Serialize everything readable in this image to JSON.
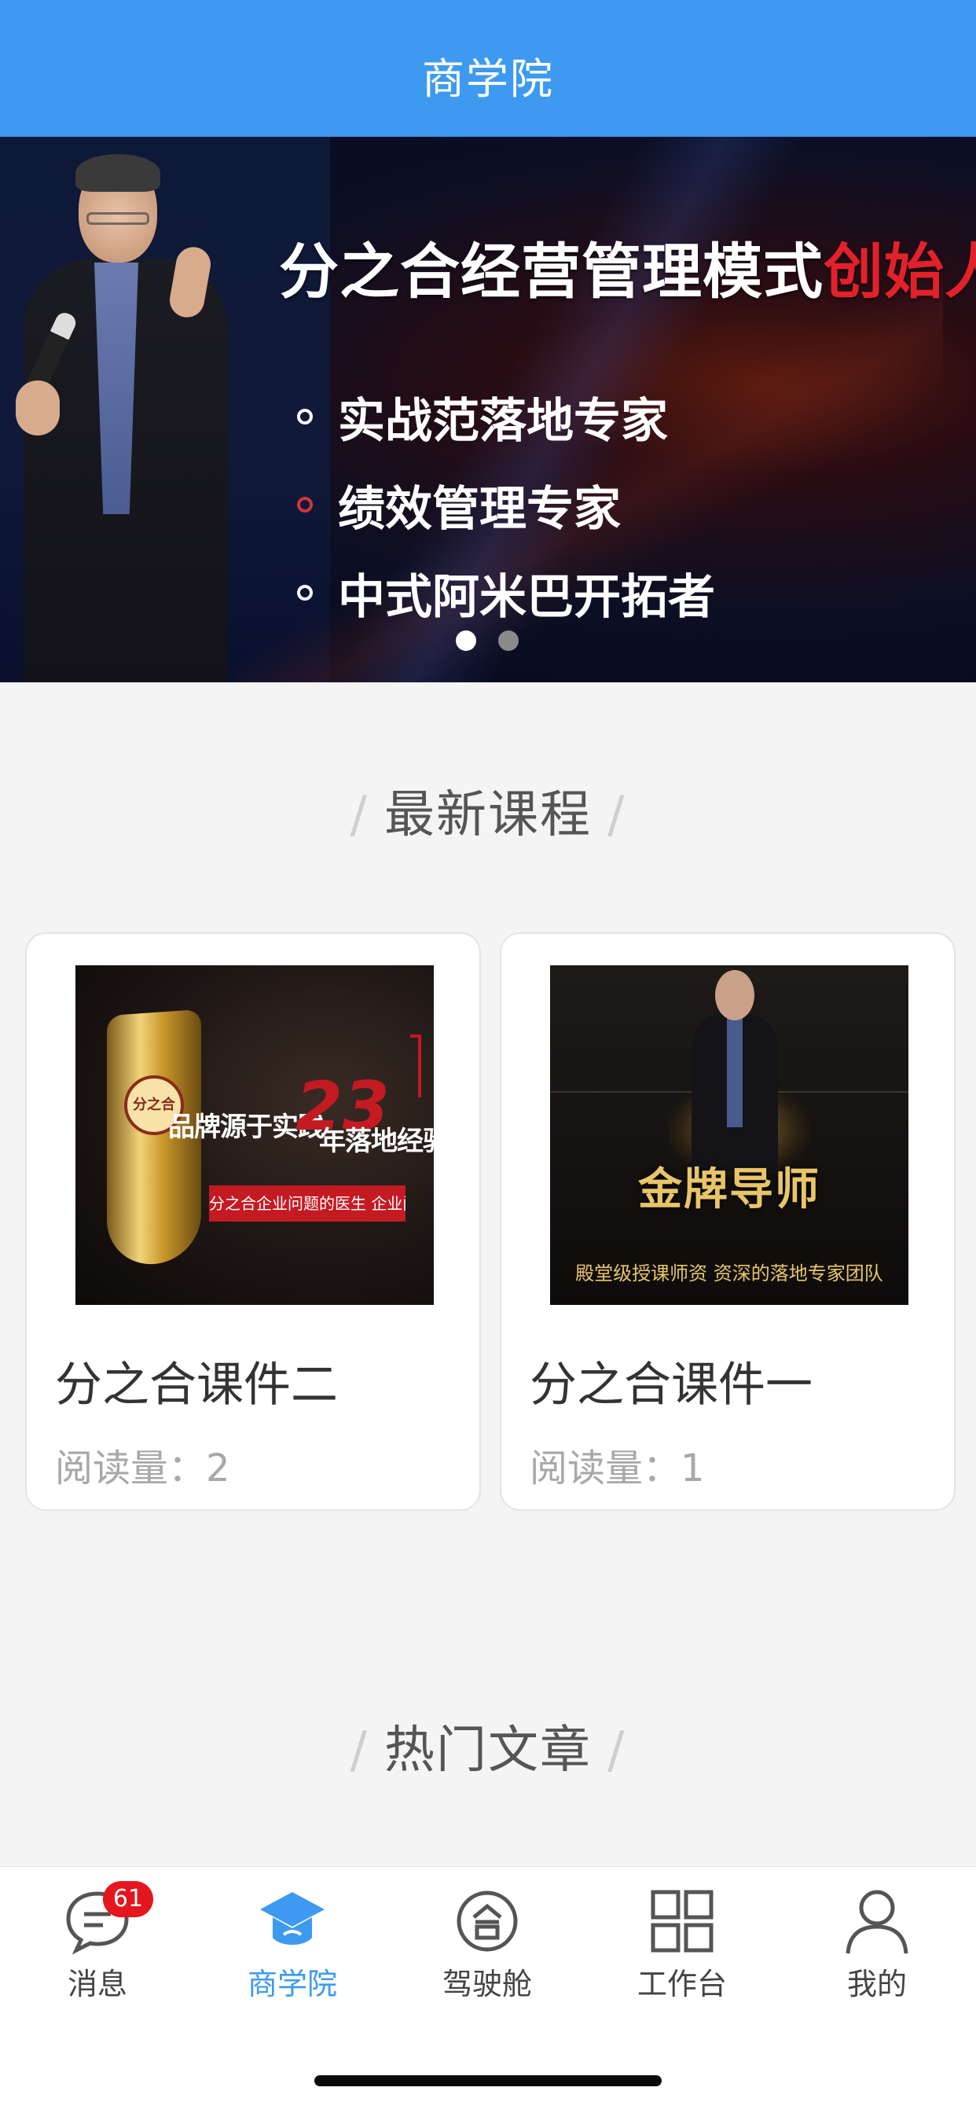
{
  "header": {
    "title": "商学院"
  },
  "banner": {
    "headline_main": "分之合经营管理模式",
    "headline_accent": "创始人",
    "bullets": [
      "实战范落地专家",
      "绩效管理专家",
      "中式阿米巴开拓者"
    ],
    "pages": 2,
    "active_page": 1
  },
  "sections": {
    "latest_courses": "最新课程",
    "hot_articles": "热门文章",
    "slash": "/"
  },
  "courses": [
    {
      "title": "分之合课件二",
      "read_label": "阅读量：",
      "read_count": "2",
      "thumb": {
        "brand": "分之合",
        "line_a": "品牌源于实践",
        "big_number": "23",
        "line_b": "年落地经验",
        "bar": "分之合企业问题的医生 企业问题的解决者"
      }
    },
    {
      "title": "分之合课件一",
      "read_label": "阅读量：",
      "read_count": "1",
      "thumb": {
        "title": "金牌导师",
        "subtitle": "殿堂级授课师资  资深的落地专家团队"
      }
    }
  ],
  "tabbar": {
    "items": [
      {
        "label": "消息",
        "icon": "chat-bubble-icon",
        "badge": "61"
      },
      {
        "label": "商学院",
        "icon": "graduation-cap-icon",
        "active": true
      },
      {
        "label": "驾驶舱",
        "icon": "circle-logo-icon"
      },
      {
        "label": "工作台",
        "icon": "grid-icon"
      },
      {
        "label": "我的",
        "icon": "person-icon"
      }
    ]
  },
  "colors": {
    "primary": "#3d9af0",
    "badge": "#e5161d",
    "accent_red": "#e2212b"
  }
}
